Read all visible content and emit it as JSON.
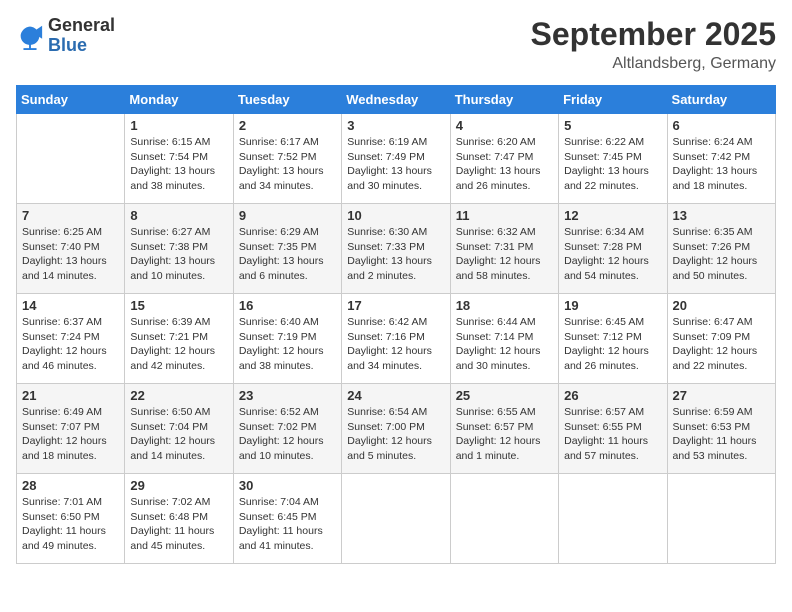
{
  "logo": {
    "general": "General",
    "blue": "Blue"
  },
  "title": "September 2025",
  "subtitle": "Altlandsberg, Germany",
  "days_of_week": [
    "Sunday",
    "Monday",
    "Tuesday",
    "Wednesday",
    "Thursday",
    "Friday",
    "Saturday"
  ],
  "weeks": [
    [
      {
        "day": "",
        "info": ""
      },
      {
        "day": "1",
        "info": "Sunrise: 6:15 AM\nSunset: 7:54 PM\nDaylight: 13 hours\nand 38 minutes."
      },
      {
        "day": "2",
        "info": "Sunrise: 6:17 AM\nSunset: 7:52 PM\nDaylight: 13 hours\nand 34 minutes."
      },
      {
        "day": "3",
        "info": "Sunrise: 6:19 AM\nSunset: 7:49 PM\nDaylight: 13 hours\nand 30 minutes."
      },
      {
        "day": "4",
        "info": "Sunrise: 6:20 AM\nSunset: 7:47 PM\nDaylight: 13 hours\nand 26 minutes."
      },
      {
        "day": "5",
        "info": "Sunrise: 6:22 AM\nSunset: 7:45 PM\nDaylight: 13 hours\nand 22 minutes."
      },
      {
        "day": "6",
        "info": "Sunrise: 6:24 AM\nSunset: 7:42 PM\nDaylight: 13 hours\nand 18 minutes."
      }
    ],
    [
      {
        "day": "7",
        "info": "Sunrise: 6:25 AM\nSunset: 7:40 PM\nDaylight: 13 hours\nand 14 minutes."
      },
      {
        "day": "8",
        "info": "Sunrise: 6:27 AM\nSunset: 7:38 PM\nDaylight: 13 hours\nand 10 minutes."
      },
      {
        "day": "9",
        "info": "Sunrise: 6:29 AM\nSunset: 7:35 PM\nDaylight: 13 hours\nand 6 minutes."
      },
      {
        "day": "10",
        "info": "Sunrise: 6:30 AM\nSunset: 7:33 PM\nDaylight: 13 hours\nand 2 minutes."
      },
      {
        "day": "11",
        "info": "Sunrise: 6:32 AM\nSunset: 7:31 PM\nDaylight: 12 hours\nand 58 minutes."
      },
      {
        "day": "12",
        "info": "Sunrise: 6:34 AM\nSunset: 7:28 PM\nDaylight: 12 hours\nand 54 minutes."
      },
      {
        "day": "13",
        "info": "Sunrise: 6:35 AM\nSunset: 7:26 PM\nDaylight: 12 hours\nand 50 minutes."
      }
    ],
    [
      {
        "day": "14",
        "info": "Sunrise: 6:37 AM\nSunset: 7:24 PM\nDaylight: 12 hours\nand 46 minutes."
      },
      {
        "day": "15",
        "info": "Sunrise: 6:39 AM\nSunset: 7:21 PM\nDaylight: 12 hours\nand 42 minutes."
      },
      {
        "day": "16",
        "info": "Sunrise: 6:40 AM\nSunset: 7:19 PM\nDaylight: 12 hours\nand 38 minutes."
      },
      {
        "day": "17",
        "info": "Sunrise: 6:42 AM\nSunset: 7:16 PM\nDaylight: 12 hours\nand 34 minutes."
      },
      {
        "day": "18",
        "info": "Sunrise: 6:44 AM\nSunset: 7:14 PM\nDaylight: 12 hours\nand 30 minutes."
      },
      {
        "day": "19",
        "info": "Sunrise: 6:45 AM\nSunset: 7:12 PM\nDaylight: 12 hours\nand 26 minutes."
      },
      {
        "day": "20",
        "info": "Sunrise: 6:47 AM\nSunset: 7:09 PM\nDaylight: 12 hours\nand 22 minutes."
      }
    ],
    [
      {
        "day": "21",
        "info": "Sunrise: 6:49 AM\nSunset: 7:07 PM\nDaylight: 12 hours\nand 18 minutes."
      },
      {
        "day": "22",
        "info": "Sunrise: 6:50 AM\nSunset: 7:04 PM\nDaylight: 12 hours\nand 14 minutes."
      },
      {
        "day": "23",
        "info": "Sunrise: 6:52 AM\nSunset: 7:02 PM\nDaylight: 12 hours\nand 10 minutes."
      },
      {
        "day": "24",
        "info": "Sunrise: 6:54 AM\nSunset: 7:00 PM\nDaylight: 12 hours\nand 5 minutes."
      },
      {
        "day": "25",
        "info": "Sunrise: 6:55 AM\nSunset: 6:57 PM\nDaylight: 12 hours\nand 1 minute."
      },
      {
        "day": "26",
        "info": "Sunrise: 6:57 AM\nSunset: 6:55 PM\nDaylight: 11 hours\nand 57 minutes."
      },
      {
        "day": "27",
        "info": "Sunrise: 6:59 AM\nSunset: 6:53 PM\nDaylight: 11 hours\nand 53 minutes."
      }
    ],
    [
      {
        "day": "28",
        "info": "Sunrise: 7:01 AM\nSunset: 6:50 PM\nDaylight: 11 hours\nand 49 minutes."
      },
      {
        "day": "29",
        "info": "Sunrise: 7:02 AM\nSunset: 6:48 PM\nDaylight: 11 hours\nand 45 minutes."
      },
      {
        "day": "30",
        "info": "Sunrise: 7:04 AM\nSunset: 6:45 PM\nDaylight: 11 hours\nand 41 minutes."
      },
      {
        "day": "",
        "info": ""
      },
      {
        "day": "",
        "info": ""
      },
      {
        "day": "",
        "info": ""
      },
      {
        "day": "",
        "info": ""
      }
    ]
  ]
}
